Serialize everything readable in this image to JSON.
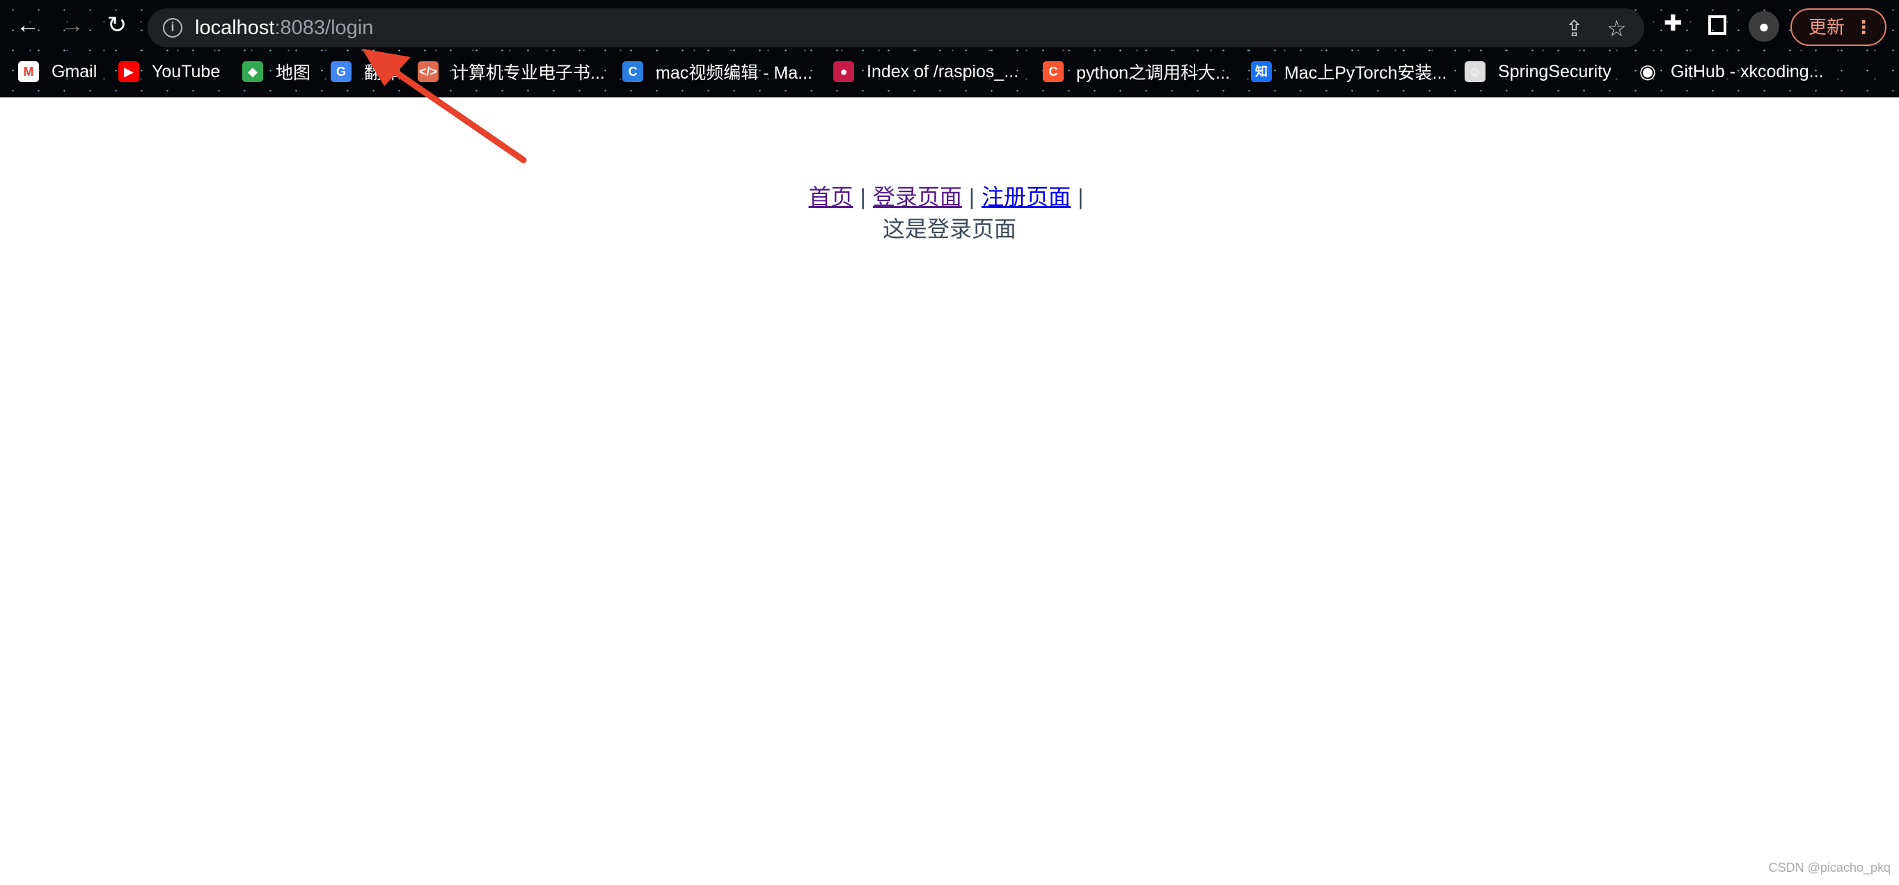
{
  "browser": {
    "url_host": "localhost",
    "url_rest": ":8083/login",
    "update_label": "更新",
    "icons": [
      "back-icon",
      "forward-icon",
      "reload-icon",
      "info-icon",
      "share-icon",
      "star-icon",
      "extensions-icon",
      "sidepanel-icon",
      "profile-icon",
      "menu-icon"
    ],
    "bookmarks": [
      {
        "label": "Gmail",
        "icon": "gmail-icon",
        "color": "#ea4335"
      },
      {
        "label": "YouTube",
        "icon": "youtube-icon",
        "color": "#ff0000"
      },
      {
        "label": "地图",
        "icon": "maps-icon",
        "color": "#34a853"
      },
      {
        "label": "翻译",
        "icon": "translate-icon",
        "color": "#4285f4"
      },
      {
        "label": "计算机专业电子书...",
        "icon": "code-icon",
        "color": "#e06a50"
      },
      {
        "label": "mac视频编辑 - Ma...",
        "icon": "c-icon",
        "color": "#2a7de1"
      },
      {
        "label": "Index of /raspios_...",
        "icon": "raspberry-icon",
        "color": "#c51a4a"
      },
      {
        "label": "python之调用科大...",
        "icon": "csdn-icon",
        "color": "#fc5531"
      },
      {
        "label": "Mac上PyTorch安装...",
        "icon": "zhihu-icon",
        "color": "#1772f6"
      },
      {
        "label": "SpringSecurity",
        "icon": "avatar-icon",
        "color": "#ddd"
      },
      {
        "label": "GitHub - xkcoding...",
        "icon": "github-icon",
        "color": "#000"
      }
    ]
  },
  "page": {
    "nav": [
      {
        "label": "首页",
        "visited": true
      },
      {
        "label": "登录页面",
        "visited": true
      },
      {
        "label": "注册页面",
        "visited": false
      }
    ],
    "separator": "|",
    "message": "这是登录页面"
  },
  "watermark": "CSDN @picacho_pkq",
  "annotation": {
    "type": "arrow",
    "color": "#e8412c"
  }
}
